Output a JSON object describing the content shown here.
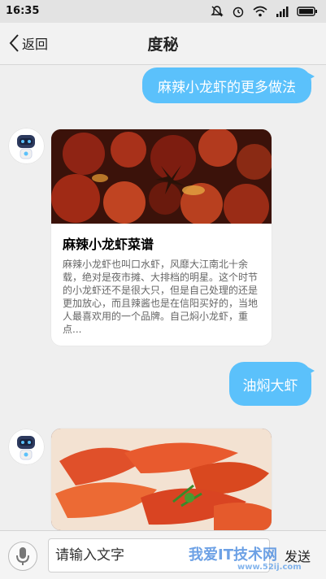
{
  "status_bar": {
    "time": "16:35"
  },
  "header": {
    "back_label": "返回",
    "title": "度秘"
  },
  "messages": {
    "user_1": "麻辣小龙虾的更多做法",
    "card_1": {
      "title": "麻辣小龙虾菜谱",
      "text": "麻辣小龙虾也叫口水虾，风靡大江南北十余载，绝对是夜市摊、大排档的明星。这个时节的小龙虾还不是很大只，但是自己处理的还是更加放心，而且辣酱也是在信阳买好的，当地人最喜欢用的一个品牌。自己焖小龙虾，重点..."
    },
    "user_2": "油焖大虾"
  },
  "input_bar": {
    "placeholder": "请输入文字",
    "send_label": "发送"
  },
  "watermark": {
    "text": "我爱IT技术网",
    "url": "www.52ij.com"
  },
  "colors": {
    "user_bubble": "#5bc1fb",
    "background": "#efefef"
  }
}
